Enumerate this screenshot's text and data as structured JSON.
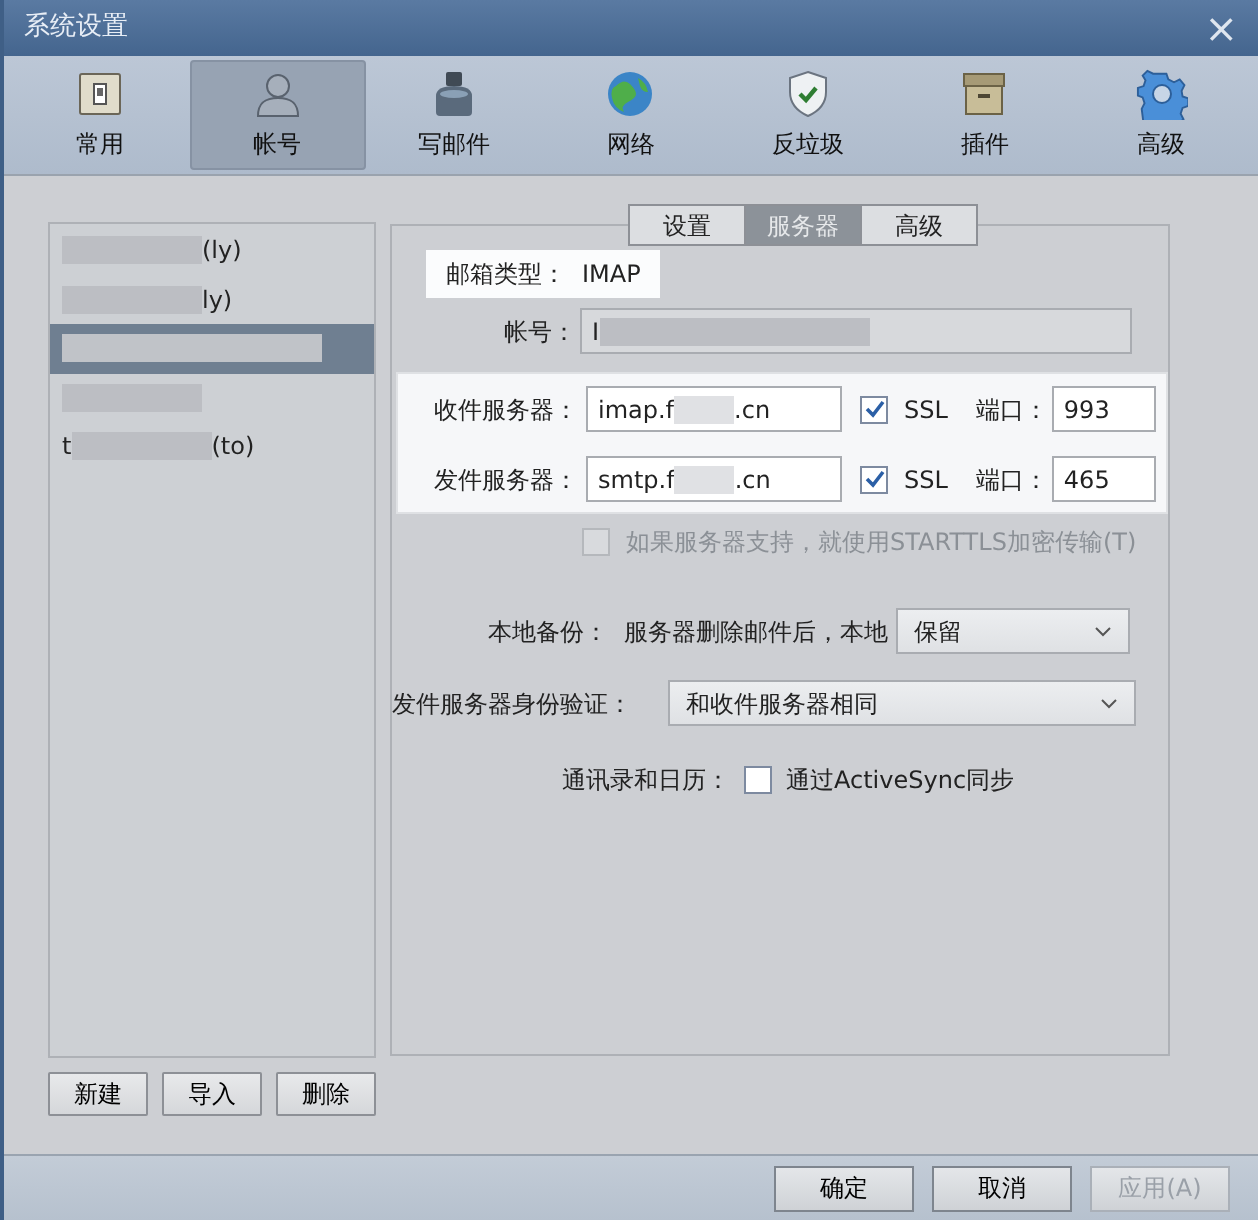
{
  "window": {
    "title": "系统设置",
    "close": "×"
  },
  "toolbar": [
    {
      "kind": "general",
      "label": "常用",
      "selected": false
    },
    {
      "kind": "account",
      "label": "帐号",
      "selected": true
    },
    {
      "kind": "compose",
      "label": "写邮件",
      "selected": false
    },
    {
      "kind": "network",
      "label": "网络",
      "selected": false
    },
    {
      "kind": "antispam",
      "label": "反垃圾",
      "selected": false
    },
    {
      "kind": "plugin",
      "label": "插件",
      "selected": false
    },
    {
      "kind": "advanced",
      "label": "高级",
      "selected": false
    }
  ],
  "accounts": [
    {
      "selected": false,
      "segments": [
        {
          "kind": "redacted"
        },
        {
          "kind": "text",
          "text": "(ly)"
        }
      ]
    },
    {
      "selected": false,
      "segments": [
        {
          "kind": "redacted"
        },
        {
          "kind": "text",
          "text": "ly)"
        }
      ]
    },
    {
      "selected": true,
      "segments": [
        {
          "kind": "redacted"
        }
      ]
    },
    {
      "selected": false,
      "segments": [
        {
          "kind": "redacted"
        }
      ]
    },
    {
      "selected": false,
      "segments": [
        {
          "kind": "text",
          "text": "t"
        },
        {
          "kind": "redacted"
        },
        {
          "kind": "text",
          "text": "(to)"
        }
      ]
    }
  ],
  "account_buttons": [
    "新建",
    "导入",
    "删除"
  ],
  "tabs": [
    {
      "label": "设置",
      "selected": false
    },
    {
      "label": "服务器",
      "selected": true
    },
    {
      "label": "高级",
      "selected": false
    }
  ],
  "mailbox_type": {
    "label": "邮箱类型：",
    "value": "IMAP"
  },
  "account": {
    "label": "帐号：",
    "segments": [
      {
        "kind": "text",
        "text": "I"
      },
      {
        "kind": "redacted"
      }
    ]
  },
  "servers": [
    {
      "label": "收件服务器：",
      "segments": [
        {
          "kind": "text",
          "text": "imap.f"
        },
        {
          "kind": "redacted"
        },
        {
          "kind": "text",
          "text": ".cn"
        }
      ],
      "ssl": {
        "label": "SSL",
        "checked": true
      },
      "port_label": "端口：",
      "port": "993"
    },
    {
      "label": "发件服务器：",
      "segments": [
        {
          "kind": "text",
          "text": "smtp.f"
        },
        {
          "kind": "redacted"
        },
        {
          "kind": "text",
          "text": ".cn"
        }
      ],
      "ssl": {
        "label": "SSL",
        "checked": true
      },
      "port_label": "端口：",
      "port": "465"
    }
  ],
  "starttls": {
    "label": "如果服务器支持，就使用STARTTLS加密传输(T)",
    "checked": false,
    "disabled": true
  },
  "local_backup": {
    "label": "本地备份：",
    "prefix": "服务器删除邮件后，本地",
    "value": "保留"
  },
  "smtp_auth": {
    "label": "发件服务器身份验证：",
    "value": "和收件服务器相同"
  },
  "activesync": {
    "label": "通讯录和日历：",
    "option": "通过ActiveSync同步",
    "checked": false
  },
  "footer_buttons": [
    {
      "label": "确定",
      "disabled": false
    },
    {
      "label": "取消",
      "disabled": false
    },
    {
      "label": "应用(A)",
      "disabled": true
    }
  ]
}
